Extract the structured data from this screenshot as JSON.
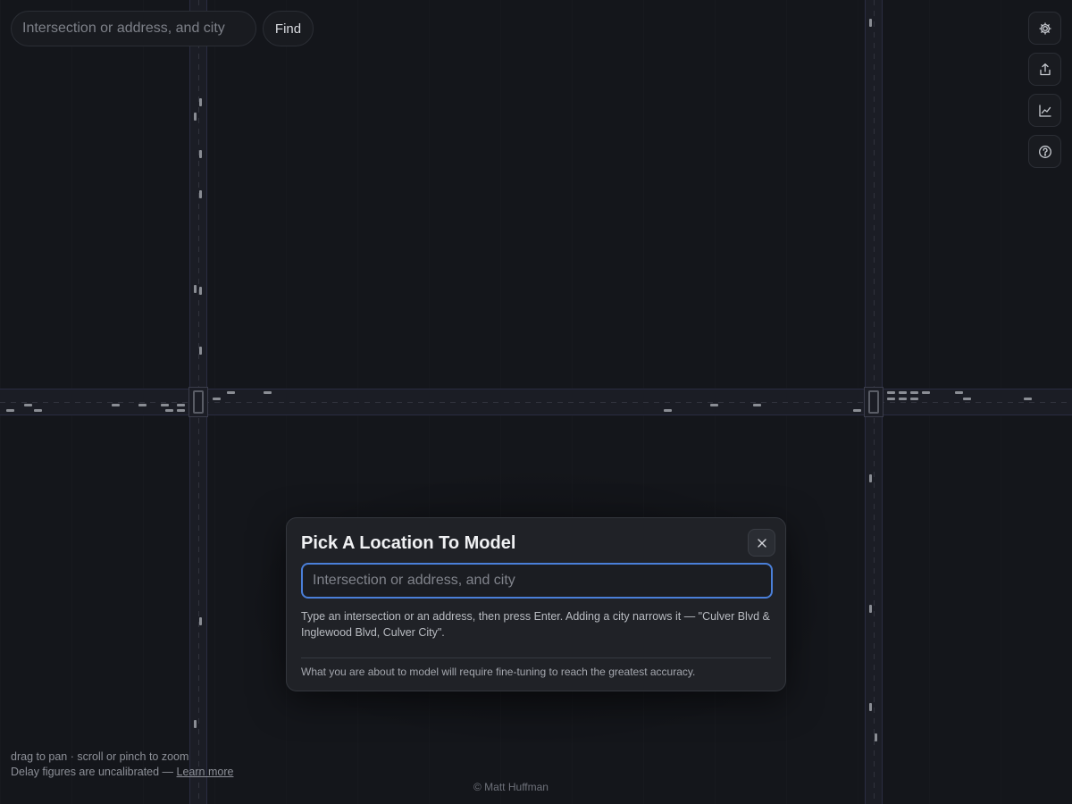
{
  "top_bar": {
    "search_placeholder": "Intersection or address, and city",
    "search_value": "",
    "find_label": "Find"
  },
  "toolbar": {
    "items": [
      {
        "icon": "gear-icon",
        "name": "settings"
      },
      {
        "icon": "share-icon",
        "name": "share"
      },
      {
        "icon": "chart-icon",
        "name": "stats"
      },
      {
        "icon": "help-icon",
        "name": "help"
      }
    ]
  },
  "map": {
    "hint_pan": "drag to pan · scroll or pinch to zoom",
    "delay_note": "Delay figures are uncalibrated —",
    "learn_more": "Learn more",
    "credit": "© Matt Huffman"
  },
  "modal": {
    "title": "Pick A Location To Model",
    "input_placeholder": "Intersection or address, and city",
    "input_value": "",
    "help_text": "Type an intersection or an address, then press Enter. Adding a city narrows it — \"Culver Blvd & Inglewood Blvd, Culver City\".",
    "note": "What you are about to model will require fine-tuning to reach the greatest accuracy.",
    "close_icon": "close-icon"
  },
  "colors": {
    "background": "#14161b",
    "road": "#1b1d25",
    "road_edge": "#2a2c42",
    "accent_focus": "#4a7fd9",
    "panel": "#202227"
  }
}
